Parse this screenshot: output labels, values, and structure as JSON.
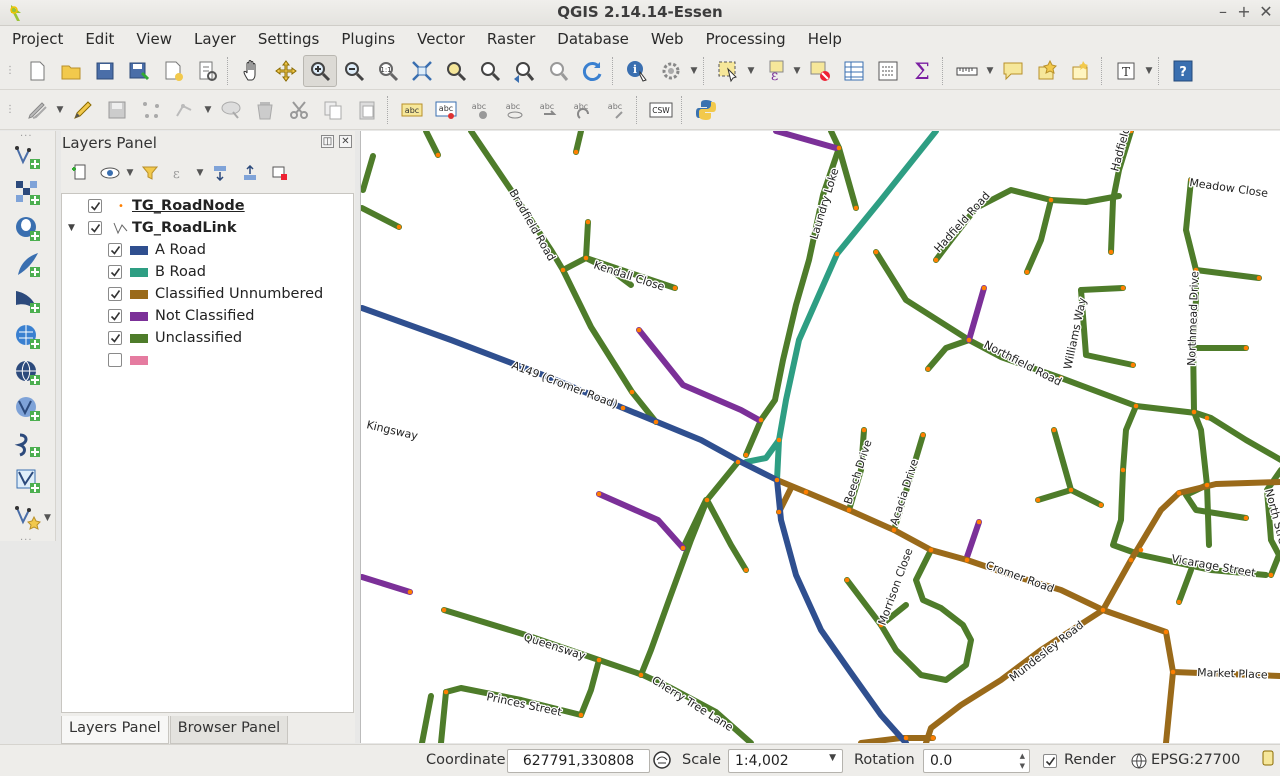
{
  "app": {
    "title": "QGIS 2.14.14-Essen"
  },
  "menu": [
    "Project",
    "Edit",
    "View",
    "Layer",
    "Settings",
    "Plugins",
    "Vector",
    "Raster",
    "Database",
    "Web",
    "Processing",
    "Help"
  ],
  "toolbar1": [
    "new-project-icon",
    "open-project-icon",
    "save-project-icon",
    "save-as-icon",
    "new-print-composer-icon",
    "composer-manager-icon",
    "pan-icon",
    "pan-to-selection-icon",
    "zoom-in-icon",
    "zoom-out-icon",
    "zoom-actual-icon",
    "zoom-full-icon",
    "zoom-to-selection-icon",
    "zoom-to-layer-icon",
    "zoom-last-icon",
    "zoom-next-icon",
    "refresh-icon",
    "identify-icon",
    "run-action-icon",
    "select-features-icon",
    "select-by-expression-icon",
    "deselect-icon",
    "attribute-table-icon",
    "field-calculator-icon",
    "statistics-icon",
    "measure-icon",
    "map-tips-icon",
    "new-bookmark-icon",
    "show-bookmarks-icon",
    "text-annotation-icon",
    "help-icon"
  ],
  "toolbar2": [
    "edits-icon",
    "toggle-editing-icon",
    "save-edits-icon",
    "digitize-icon",
    "node-tool-icon",
    "move-feature-icon",
    "delete-selected-icon",
    "cut-features-icon",
    "copy-features-icon",
    "paste-features-icon",
    "label-icon",
    "label-pin-icon",
    "label-move-icon",
    "label-show-icon",
    "label-rotate-icon",
    "label-change-icon",
    "csw-icon",
    "python-console-icon"
  ],
  "toolbar2_labels": {
    "abc": "abc",
    "csw": "CSW"
  },
  "left_toolbar": [
    "add-vector-layer-icon",
    "add-raster-layer-icon",
    "add-postgis-layer-icon",
    "add-spatialite-layer-icon",
    "add-mssql-layer-icon",
    "add-wms-layer-icon",
    "add-wcs-layer-icon",
    "add-wfs-layer-icon",
    "add-delimited-text-icon",
    "add-virtual-layer-icon",
    "new-shapefile-icon"
  ],
  "layers_panel": {
    "title": "Layers Panel",
    "layers": [
      {
        "name": "TG_RoadNode",
        "checked": true
      },
      {
        "name": "TG_RoadLink",
        "checked": true
      }
    ],
    "legend": [
      {
        "label": "A Road",
        "color": "#2f4f8f",
        "checked": true
      },
      {
        "label": "B Road",
        "color": "#2e9e83",
        "checked": true
      },
      {
        "label": "Classified Unnumbered",
        "color": "#9a6a1a",
        "checked": true
      },
      {
        "label": "Not Classified",
        "color": "#7b3098",
        "checked": true
      },
      {
        "label": "Unclassified",
        "color": "#4e7c2a",
        "checked": true
      },
      {
        "label": "",
        "color": "#e57ba0",
        "checked": false
      }
    ]
  },
  "tabs": [
    "Layers Panel",
    "Browser Panel"
  ],
  "map_labels": [
    "Bradfield Road",
    "Kendall Close",
    "Laundry Loke",
    "Hadfield Road",
    "Meadow Close",
    "A149 (Cromer Road)",
    "Kingsway",
    "Northfield Road",
    "Williams Way",
    "Northmead Drive",
    "Beech Drive",
    "Acacia Drive",
    "Cromer Road",
    "Morrison Close",
    "Queensway",
    "Princes Street",
    "Cherry Tree Lane",
    "Mundesley Road",
    "Market Place",
    "Vicarage Street",
    "North Street"
  ],
  "status": {
    "coordinate_label": "Coordinate",
    "coordinate_value": "627791,330808",
    "scale_label": "Scale",
    "scale_value": "1:4,002",
    "rotation_label": "Rotation",
    "rotation_value": "0.0",
    "render_label": "Render",
    "crs": "EPSG:27700"
  },
  "colors": {
    "a_road": "#2f4f8f",
    "b_road": "#2e9e83",
    "classified": "#9a6a1a",
    "not_classified": "#7b3098",
    "unclassified": "#4e7c2a",
    "node": "#ff7f00"
  }
}
